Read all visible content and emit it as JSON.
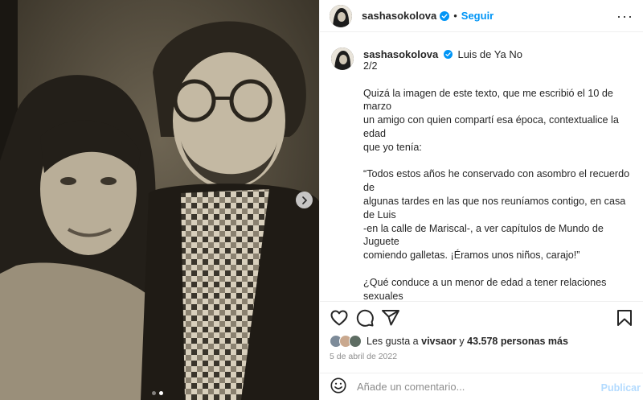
{
  "post": {
    "author": "sashasokolova",
    "follow_label": "Seguir",
    "separator": "•",
    "more_label": "···"
  },
  "caption": {
    "author": "sashasokolova",
    "audio": "Luis de Ya No",
    "page": "2/2",
    "body": "Quizá la imagen de este texto, que me escribió el 10 de marzo\nun amigo con quien compartí esa época, contextualice la edad\nque yo tenía:\n\n“Todos estos años he conservado con asombro el recuerdo de\nalgunas tardes en las que nos reuníamos contigo, en casa de Luis\n-en la calle de Mariscal-, a ver capítulos de Mundo de Juguete\ncomiendo galletas. ¡Éramos unos niños, carajo!”\n\n¿Qué conduce a un menor de edad a tener relaciones sexuales\ncon un adulto?\n\nEl término es conocido como GROOMING: “Es una serie de\nconductas y acciones emprendidas por un adulto, con el objetivo\ndeliberado de ganarse la confianza de un menor de edad,\ncreando una conexión emocional, con el fin de abusar\nsexualmente de él.”"
  },
  "likes": {
    "prefix": "Les gusta a",
    "user": "vivsaor",
    "connector": "y",
    "count": "43.578 personas más"
  },
  "date": "5 de abril de 2022",
  "comment": {
    "placeholder": "Añade un comentario...",
    "publish_label": "Publicar"
  },
  "colors": {
    "accent": "#0095f6",
    "publish_disabled": "#b3dbff",
    "verified": "#0095f6"
  },
  "icons": [
    "verified-icon",
    "more-icon",
    "heart-icon",
    "comment-icon",
    "share-icon",
    "bookmark-icon",
    "emoji-icon",
    "chevron-right-icon"
  ],
  "carousel": {
    "current": 2,
    "total": 2
  }
}
